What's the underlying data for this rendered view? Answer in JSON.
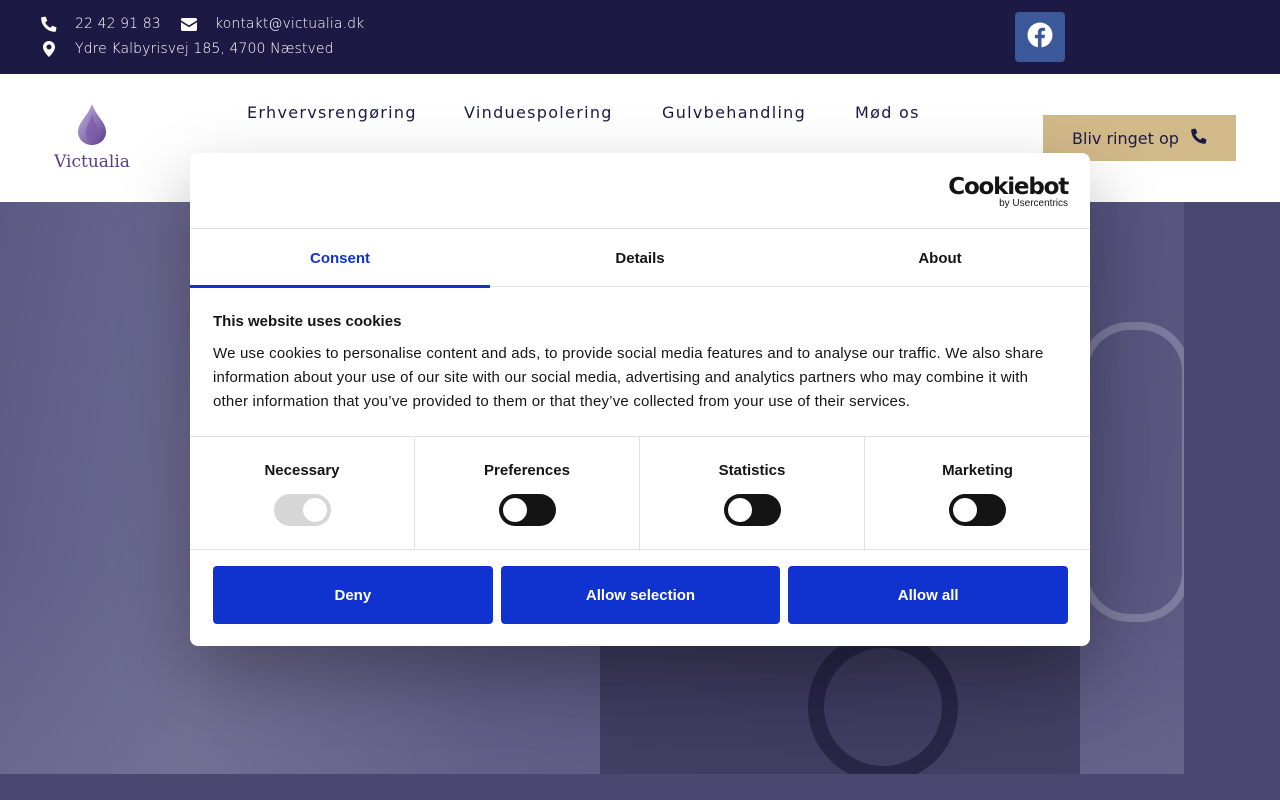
{
  "topbar": {
    "phone": "22 42 91 83",
    "email": "kontakt@victualia.dk",
    "address": "Ydre Kalbyrisvej 185, 4700 Næstved",
    "social_icon": "facebook-icon"
  },
  "header": {
    "logo_text": "Victualia",
    "nav": [
      "Erhvervsrengøring",
      "Vinduespolering",
      "Gulvbehandling",
      "Mød os"
    ],
    "call_button": "Bliv ringet op"
  },
  "cookie_dialog": {
    "brand": "Cookiebot",
    "brand_sub": "by Usercentrics",
    "tabs": [
      "Consent",
      "Details",
      "About"
    ],
    "active_tab": "Consent",
    "heading": "This website uses cookies",
    "text": "We use cookies to personalise content and ads, to provide social media features and to analyse our traffic. We also share information about your use of our site with our social media, advertising and analytics partners who may combine it with other information that you’ve provided to them or that they’ve collected from your use of their services.",
    "categories": [
      {
        "label": "Necessary",
        "state": "on-disabled"
      },
      {
        "label": "Preferences",
        "state": "off"
      },
      {
        "label": "Statistics",
        "state": "off"
      },
      {
        "label": "Marketing",
        "state": "off"
      }
    ],
    "buttons": [
      "Deny",
      "Allow selection",
      "Allow all"
    ]
  },
  "colors": {
    "topbar_bg": "#1c1a45",
    "accent_gold": "#d2b98a",
    "cookiebot_blue": "#1032cf",
    "facebook_blue": "#3b5998"
  }
}
